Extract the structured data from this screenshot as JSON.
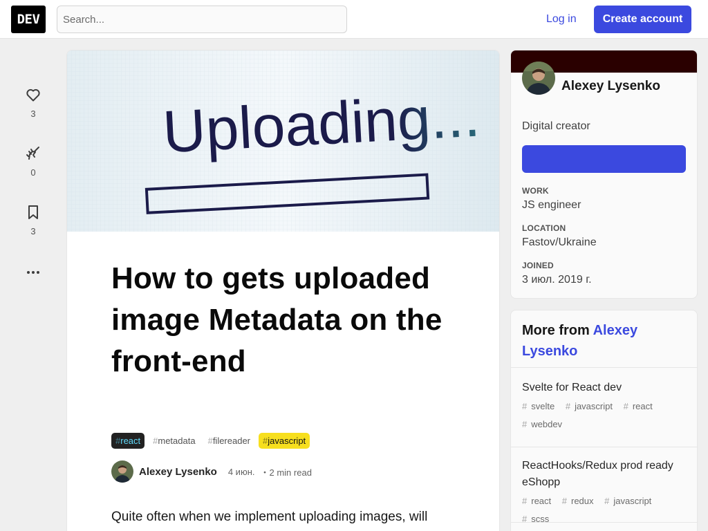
{
  "header": {
    "logo_text": "DEV",
    "search_placeholder": "Search...",
    "login_label": "Log in",
    "create_account_label": "Create account"
  },
  "reactions": [
    {
      "icon": "heart-icon",
      "count": "3"
    },
    {
      "icon": "unicorn-icon",
      "count": "0"
    },
    {
      "icon": "bookmark-icon",
      "count": "3"
    }
  ],
  "article": {
    "cover_word": "Uploading...",
    "title": "How to gets uploaded image Metadata on the front-end",
    "tags": [
      {
        "hash": "#",
        "name": "react"
      },
      {
        "hash": "#",
        "name": "metadata"
      },
      {
        "hash": "#",
        "name": "filereader"
      },
      {
        "hash": "#",
        "name": "javascript"
      }
    ],
    "author": "Alexey Lysenko",
    "date": "4 июн.",
    "read_time": "・2 min read",
    "body": "Quite often when we implement uploading images, will"
  },
  "profile": {
    "name": "Alexey Lysenko",
    "bio": "Digital creator",
    "work_label": "WORK",
    "work_value": "JS engineer",
    "location_label": "LOCATION",
    "location_value": "Fastov/Ukraine",
    "joined_label": "JOINED",
    "joined_value": "3 июл. 2019 г.",
    "accent_color": "#2a0000",
    "button_color": "#3b49df"
  },
  "more_from": {
    "prefix": "More from ",
    "author_first": "Alexey",
    "author_last": "Lysenko",
    "items": [
      {
        "title": "Svelte for React dev",
        "tags": [
          "svelte",
          "javascript",
          "react",
          "webdev"
        ]
      },
      {
        "title": "ReactHooks/Redux prod ready eShopp",
        "tags": [
          "react",
          "redux",
          "javascript",
          "scss"
        ]
      }
    ]
  }
}
